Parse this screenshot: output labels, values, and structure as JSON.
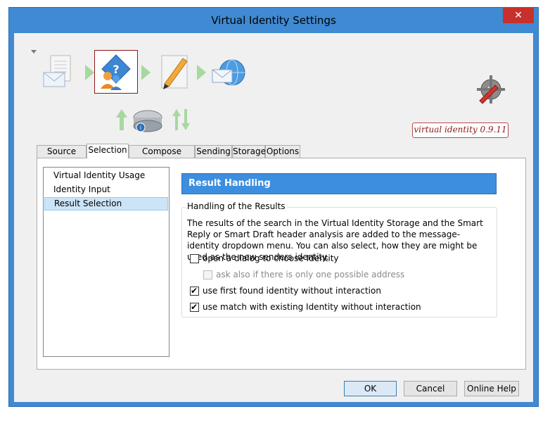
{
  "window": {
    "title": "Virtual Identity Settings",
    "close_glyph": "✕"
  },
  "header": {
    "version": "virtual identity 0.9.11",
    "icons": [
      "document-mail-icon",
      "identity-question-icon",
      "pencil-edit-icon",
      "globe-mail-icon",
      "upload-arrow-icon",
      "storage-drive-icon",
      "sync-arrows-icon",
      "settings-tools-icon"
    ]
  },
  "tabs": [
    {
      "label": "Source Mail"
    },
    {
      "label": "Selection"
    },
    {
      "label": "Compose Dialog"
    },
    {
      "label": "Sending"
    },
    {
      "label": "Storage"
    },
    {
      "label": "Options"
    }
  ],
  "sidebar": {
    "items": [
      {
        "label": "Virtual Identity Usage"
      },
      {
        "label": "Identity Input"
      },
      {
        "label": "Result Selection"
      }
    ]
  },
  "panel": {
    "heading": "Result Handling",
    "group_title": "Handling of the Results",
    "description": "The results of the search in the Virtual Identity Storage and the Smart Reply or Smart Draft header analysis are added to the message-identity dropdown menu. You can also select, how they are might be used as the new senders identity.",
    "options": [
      {
        "label": "open a dialog to choose Identity",
        "checked": false
      },
      {
        "label": "ask also if there is only one possible address",
        "checked": false,
        "disabled": true
      },
      {
        "label": "use first found identity without interaction",
        "checked": true
      },
      {
        "label": "use match with existing Identity without interaction",
        "checked": true
      }
    ]
  },
  "buttons": {
    "ok": "OK",
    "cancel": "Cancel",
    "help": "Online Help"
  },
  "colors": {
    "frame": "#3f8ad2",
    "heading_bg": "#3d8ede",
    "selection_bg": "#cce4f7",
    "close_bg": "#c7312b",
    "version_text": "#8b1a1a"
  }
}
